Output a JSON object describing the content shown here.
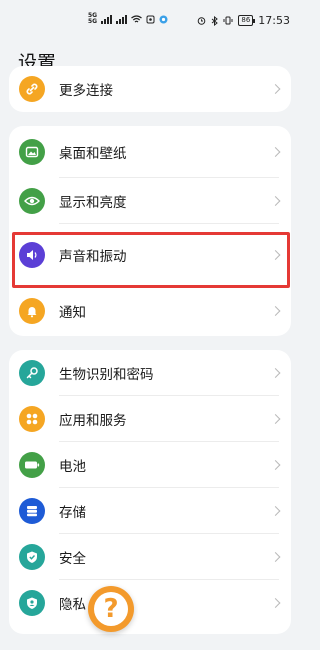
{
  "status_bar": {
    "sim1_label": "5G",
    "sim2_label": "5G",
    "time": "17:53",
    "battery": "86"
  },
  "page": {
    "title": "设置"
  },
  "groups": [
    {
      "items": [
        {
          "label": "更多连接",
          "icon": "link-icon",
          "color": "#f5a623"
        }
      ]
    },
    {
      "items": [
        {
          "label": "桌面和壁纸",
          "icon": "image-icon",
          "color": "#43a047"
        },
        {
          "label": "显示和亮度",
          "icon": "eye-icon",
          "color": "#43a047"
        },
        {
          "label": "声音和振动",
          "icon": "speaker-icon",
          "color": "#5b3fd6"
        },
        {
          "label": "通知",
          "icon": "bell-icon",
          "color": "#f5a623"
        }
      ]
    },
    {
      "items": [
        {
          "label": "生物识别和密码",
          "icon": "key-icon",
          "color": "#26a69a"
        },
        {
          "label": "应用和服务",
          "icon": "apps-icon",
          "color": "#f5a623"
        },
        {
          "label": "电池",
          "icon": "battery-icon",
          "color": "#43a047"
        },
        {
          "label": "存储",
          "icon": "storage-icon",
          "color": "#1e5bd6"
        },
        {
          "label": "安全",
          "icon": "shield-icon",
          "color": "#26a69a"
        },
        {
          "label": "隐私",
          "icon": "privacy-icon",
          "color": "#26a69a"
        }
      ]
    }
  ],
  "help": {
    "glyph": "?"
  },
  "colors": {
    "highlight": "#e53935",
    "background": "#f1f3f5",
    "help": "#f39a2c"
  }
}
